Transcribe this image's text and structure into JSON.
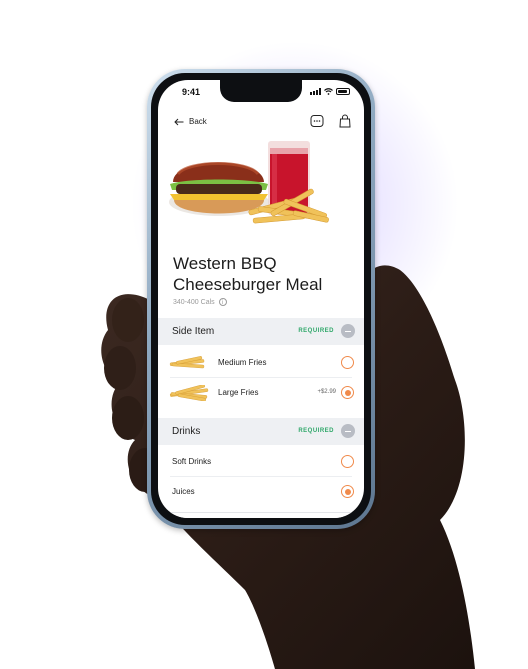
{
  "status_bar": {
    "time": "9:41"
  },
  "nav": {
    "back_label": "Back"
  },
  "product": {
    "title_line1": "Western BBQ",
    "title_line2": "Cheeseburger Meal",
    "calories": "340-400 Cals"
  },
  "sections": [
    {
      "label": "Side Item",
      "badge": "REQUIRED",
      "options": [
        {
          "name": "Medium Fries",
          "price": "",
          "selected": false
        },
        {
          "name": "Large Fries",
          "price": "+$2.99",
          "selected": true
        }
      ]
    },
    {
      "label": "Drinks",
      "badge": "REQUIRED",
      "options": [
        {
          "name": "Soft Drinks",
          "price": "",
          "selected": false
        },
        {
          "name": "Juices",
          "price": "",
          "selected": true
        }
      ]
    }
  ],
  "colors": {
    "accent": "#f08a4b",
    "required": "#2fa86a",
    "section_bg": "#eef0f3",
    "glow": "#b9a8ff"
  },
  "icons": [
    "back-arrow-icon",
    "chat-icon",
    "bag-icon",
    "info-icon",
    "collapse-icon"
  ]
}
